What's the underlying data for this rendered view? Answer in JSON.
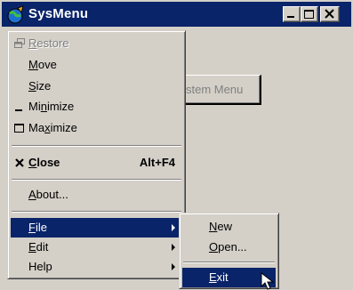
{
  "window": {
    "title": "SysMenu",
    "app_icon": "app-globe-icon",
    "background_button_label": "stem Menu",
    "title_buttons": [
      "minimize-icon",
      "maximize-icon",
      "close-icon"
    ]
  },
  "system_menu": {
    "items": [
      {
        "label": "Restore",
        "mnemonic": "R",
        "icon": "restore-icon",
        "disabled": true
      },
      {
        "label": "Move",
        "mnemonic": "M"
      },
      {
        "label": "Size",
        "mnemonic": "S"
      },
      {
        "label": "Minimize",
        "mnemonic": "n",
        "icon": "minimize-glyph-icon"
      },
      {
        "label": "Maximize",
        "mnemonic": "x",
        "icon": "maximize-glyph-icon"
      },
      {
        "label": "Close",
        "mnemonic": "C",
        "icon": "close-x-icon",
        "accelerator": "Alt+F4",
        "bold": true
      },
      {
        "label": "About...",
        "mnemonic": "A"
      },
      {
        "label": "File",
        "mnemonic": "F",
        "submenu": true,
        "selected": true
      },
      {
        "label": "Edit",
        "mnemonic": "E",
        "submenu": true
      },
      {
        "label": "Help",
        "submenu": true
      }
    ]
  },
  "file_submenu": {
    "items": [
      {
        "label": "New",
        "mnemonic": "N"
      },
      {
        "label": "Open...",
        "mnemonic": "O"
      },
      {
        "label": "Exit",
        "mnemonic": "E",
        "selected": true
      }
    ]
  },
  "colors": {
    "selection": "#0a246a",
    "face": "#d4d0c8",
    "disabled_text": "#808080"
  }
}
